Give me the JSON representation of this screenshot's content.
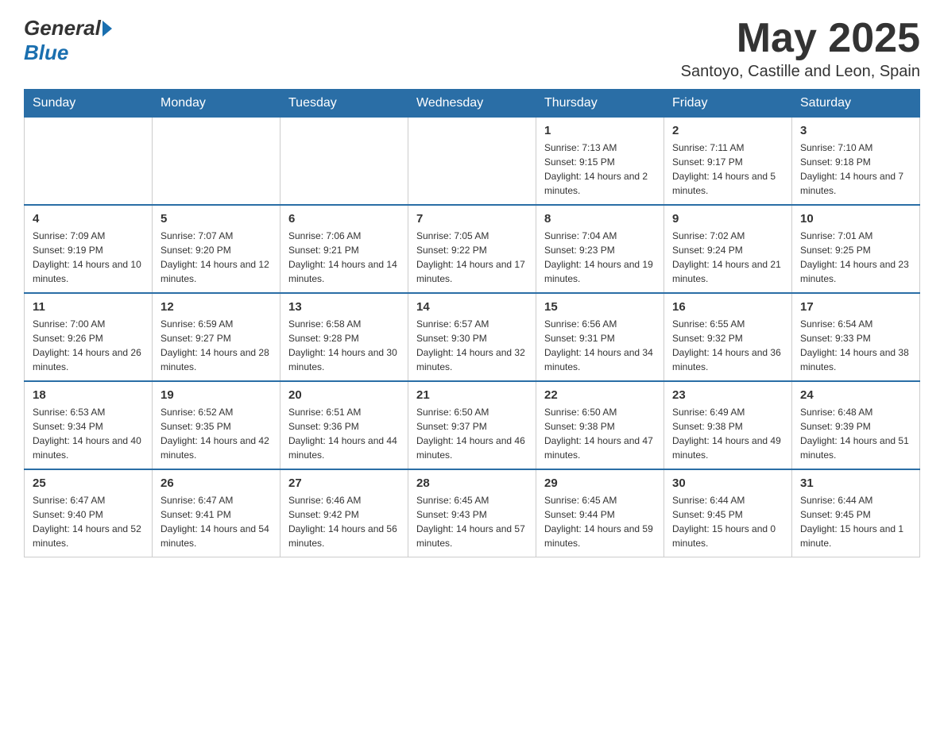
{
  "header": {
    "logo_general": "General",
    "logo_blue": "Blue",
    "month_year": "May 2025",
    "location": "Santoyo, Castille and Leon, Spain"
  },
  "days_of_week": [
    "Sunday",
    "Monday",
    "Tuesday",
    "Wednesday",
    "Thursday",
    "Friday",
    "Saturday"
  ],
  "weeks": [
    [
      {
        "day": "",
        "info": ""
      },
      {
        "day": "",
        "info": ""
      },
      {
        "day": "",
        "info": ""
      },
      {
        "day": "",
        "info": ""
      },
      {
        "day": "1",
        "info": "Sunrise: 7:13 AM\nSunset: 9:15 PM\nDaylight: 14 hours and 2 minutes."
      },
      {
        "day": "2",
        "info": "Sunrise: 7:11 AM\nSunset: 9:17 PM\nDaylight: 14 hours and 5 minutes."
      },
      {
        "day": "3",
        "info": "Sunrise: 7:10 AM\nSunset: 9:18 PM\nDaylight: 14 hours and 7 minutes."
      }
    ],
    [
      {
        "day": "4",
        "info": "Sunrise: 7:09 AM\nSunset: 9:19 PM\nDaylight: 14 hours and 10 minutes."
      },
      {
        "day": "5",
        "info": "Sunrise: 7:07 AM\nSunset: 9:20 PM\nDaylight: 14 hours and 12 minutes."
      },
      {
        "day": "6",
        "info": "Sunrise: 7:06 AM\nSunset: 9:21 PM\nDaylight: 14 hours and 14 minutes."
      },
      {
        "day": "7",
        "info": "Sunrise: 7:05 AM\nSunset: 9:22 PM\nDaylight: 14 hours and 17 minutes."
      },
      {
        "day": "8",
        "info": "Sunrise: 7:04 AM\nSunset: 9:23 PM\nDaylight: 14 hours and 19 minutes."
      },
      {
        "day": "9",
        "info": "Sunrise: 7:02 AM\nSunset: 9:24 PM\nDaylight: 14 hours and 21 minutes."
      },
      {
        "day": "10",
        "info": "Sunrise: 7:01 AM\nSunset: 9:25 PM\nDaylight: 14 hours and 23 minutes."
      }
    ],
    [
      {
        "day": "11",
        "info": "Sunrise: 7:00 AM\nSunset: 9:26 PM\nDaylight: 14 hours and 26 minutes."
      },
      {
        "day": "12",
        "info": "Sunrise: 6:59 AM\nSunset: 9:27 PM\nDaylight: 14 hours and 28 minutes."
      },
      {
        "day": "13",
        "info": "Sunrise: 6:58 AM\nSunset: 9:28 PM\nDaylight: 14 hours and 30 minutes."
      },
      {
        "day": "14",
        "info": "Sunrise: 6:57 AM\nSunset: 9:30 PM\nDaylight: 14 hours and 32 minutes."
      },
      {
        "day": "15",
        "info": "Sunrise: 6:56 AM\nSunset: 9:31 PM\nDaylight: 14 hours and 34 minutes."
      },
      {
        "day": "16",
        "info": "Sunrise: 6:55 AM\nSunset: 9:32 PM\nDaylight: 14 hours and 36 minutes."
      },
      {
        "day": "17",
        "info": "Sunrise: 6:54 AM\nSunset: 9:33 PM\nDaylight: 14 hours and 38 minutes."
      }
    ],
    [
      {
        "day": "18",
        "info": "Sunrise: 6:53 AM\nSunset: 9:34 PM\nDaylight: 14 hours and 40 minutes."
      },
      {
        "day": "19",
        "info": "Sunrise: 6:52 AM\nSunset: 9:35 PM\nDaylight: 14 hours and 42 minutes."
      },
      {
        "day": "20",
        "info": "Sunrise: 6:51 AM\nSunset: 9:36 PM\nDaylight: 14 hours and 44 minutes."
      },
      {
        "day": "21",
        "info": "Sunrise: 6:50 AM\nSunset: 9:37 PM\nDaylight: 14 hours and 46 minutes."
      },
      {
        "day": "22",
        "info": "Sunrise: 6:50 AM\nSunset: 9:38 PM\nDaylight: 14 hours and 47 minutes."
      },
      {
        "day": "23",
        "info": "Sunrise: 6:49 AM\nSunset: 9:38 PM\nDaylight: 14 hours and 49 minutes."
      },
      {
        "day": "24",
        "info": "Sunrise: 6:48 AM\nSunset: 9:39 PM\nDaylight: 14 hours and 51 minutes."
      }
    ],
    [
      {
        "day": "25",
        "info": "Sunrise: 6:47 AM\nSunset: 9:40 PM\nDaylight: 14 hours and 52 minutes."
      },
      {
        "day": "26",
        "info": "Sunrise: 6:47 AM\nSunset: 9:41 PM\nDaylight: 14 hours and 54 minutes."
      },
      {
        "day": "27",
        "info": "Sunrise: 6:46 AM\nSunset: 9:42 PM\nDaylight: 14 hours and 56 minutes."
      },
      {
        "day": "28",
        "info": "Sunrise: 6:45 AM\nSunset: 9:43 PM\nDaylight: 14 hours and 57 minutes."
      },
      {
        "day": "29",
        "info": "Sunrise: 6:45 AM\nSunset: 9:44 PM\nDaylight: 14 hours and 59 minutes."
      },
      {
        "day": "30",
        "info": "Sunrise: 6:44 AM\nSunset: 9:45 PM\nDaylight: 15 hours and 0 minutes."
      },
      {
        "day": "31",
        "info": "Sunrise: 6:44 AM\nSunset: 9:45 PM\nDaylight: 15 hours and 1 minute."
      }
    ]
  ]
}
